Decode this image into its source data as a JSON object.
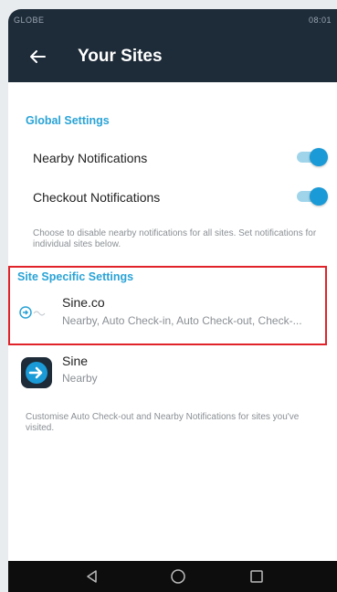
{
  "status_bar": {
    "carrier": "GLOBE",
    "right": "08:01"
  },
  "toolbar": {
    "back_icon": "arrow-left-icon",
    "title": "Your Sites"
  },
  "global_settings": {
    "title": "Global Settings",
    "nearby": {
      "label": "Nearby Notifications",
      "enabled": true
    },
    "checkout": {
      "label": "Checkout Notifications",
      "enabled": true
    },
    "hint": "Choose to disable nearby notifications for all sites. Set notifications for individual sites below."
  },
  "site_specific": {
    "title": "Site Specific Settings",
    "sites": [
      {
        "name": "Sine.co",
        "subtitle": "Nearby, Auto Check-in, Auto Check-out, Check-..."
      },
      {
        "name": "Sine",
        "subtitle": "Nearby"
      }
    ],
    "hint": "Customise Auto Check-out and Nearby Notifications for sites you've visited."
  },
  "nav_bar": {
    "back": "triangle-back-icon",
    "home": "circle-home-icon",
    "recents": "square-recents-icon"
  },
  "colors": {
    "header": "#1e2b38",
    "accent": "#2aa3d6",
    "highlight": "#e0232a"
  }
}
